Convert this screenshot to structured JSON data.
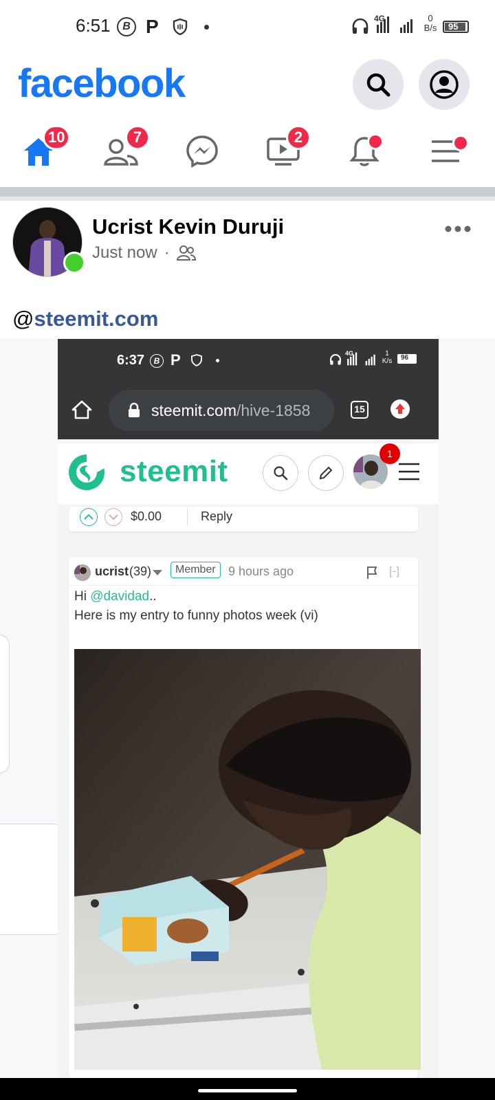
{
  "status_bar": {
    "time": "6:51",
    "net_speed_value": "0",
    "net_speed_unit": "B/s",
    "battery": "95",
    "network": "4G"
  },
  "header": {
    "logo": "facebook"
  },
  "nav": {
    "home_badge": "10",
    "friends_badge": "7",
    "watch_badge": "2"
  },
  "post": {
    "author": "Ucrist Kevin Duruji",
    "time": "Just now",
    "text_prefix": "@",
    "text_link": "steemit.com"
  },
  "shot": {
    "status_time": "6:37",
    "net_speed_value": "1",
    "net_speed_unit": "K/s",
    "battery": "96",
    "network": "4G",
    "url_host": "steemit.com",
    "url_path": "/hive-1858",
    "tab_count": "15",
    "brand": "steemit",
    "notif_badge": "1",
    "vote_amount": "$0.00",
    "reply_label": "Reply",
    "comment": {
      "user": "ucrist",
      "reputation": "(39)",
      "role": "Member",
      "time": "9 hours ago",
      "collapse": "[-]",
      "greeting_prefix": "Hi ",
      "mention": "@davidad",
      "greeting_suffix": "..",
      "body": "Here is my entry to funny photos week (vi)"
    }
  },
  "colors": {
    "facebook_blue": "#1877F2",
    "badge_red": "#F02849",
    "steemit_green": "#1FBF8F",
    "link_blue": "#385898"
  }
}
